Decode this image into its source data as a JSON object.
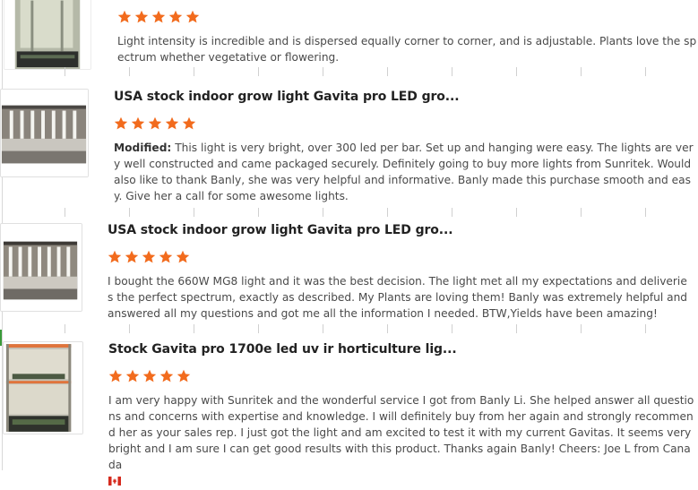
{
  "reviews": [
    {
      "title": "",
      "rating": 5,
      "modified_label": "",
      "text": "Light intensity is incredible and is dispersed equally corner to corner, and is adjustable. Plants love the spectrum whether vegetative or flowering."
    },
    {
      "title": "USA stock indoor grow light Gavita pro LED gro...",
      "rating": 5,
      "modified_label": "Modified:",
      "text": "This light is very bright, over 300 led per bar. Set up and hanging were easy. The lights are very well constructed and came packaged securely. Definitely going to buy more lights from Sunritek. Would also like to thank Banly, she was very helpful and informative. Banly made this purchase smooth and easy. Give her a call for some awesome lights."
    },
    {
      "title": "USA stock indoor grow light Gavita pro LED gro...",
      "rating": 5,
      "modified_label": "",
      "text": "I bought the 660W MG8 light and it was the best decision. The light met all my expectations and deliveries the perfect spectrum, exactly as described. My Plants are loving them! Banly was extremely helpful and answered all my questions and got me all the information I needed. BTW,Yields have been amazing!"
    },
    {
      "title": "Stock Gavita pro 1700e led uv ir horticulture lig...",
      "rating": 5,
      "modified_label": "",
      "text": "I am very happy with Sunritek and the wonderful service I got from Banly Li. She helped answer all questions and concerns with expertise and knowledge. I will definitely buy from her again and strongly recommend her as your sales rep. I just got the light and am excited to test it with my current Gavitas. It seems very bright and I am sure I can get good results with this product. Thanks again Banly! Cheers: Joe L from Canada",
      "trailing_icon": "canada-flag-icon"
    }
  ],
  "colors": {
    "star": "#f26b1d",
    "title": "#222222",
    "text": "#4a4a4a",
    "divider_tick": "#d0d0d0"
  },
  "icons": {
    "rating": "star-icon",
    "flag": "canada-flag-icon"
  }
}
